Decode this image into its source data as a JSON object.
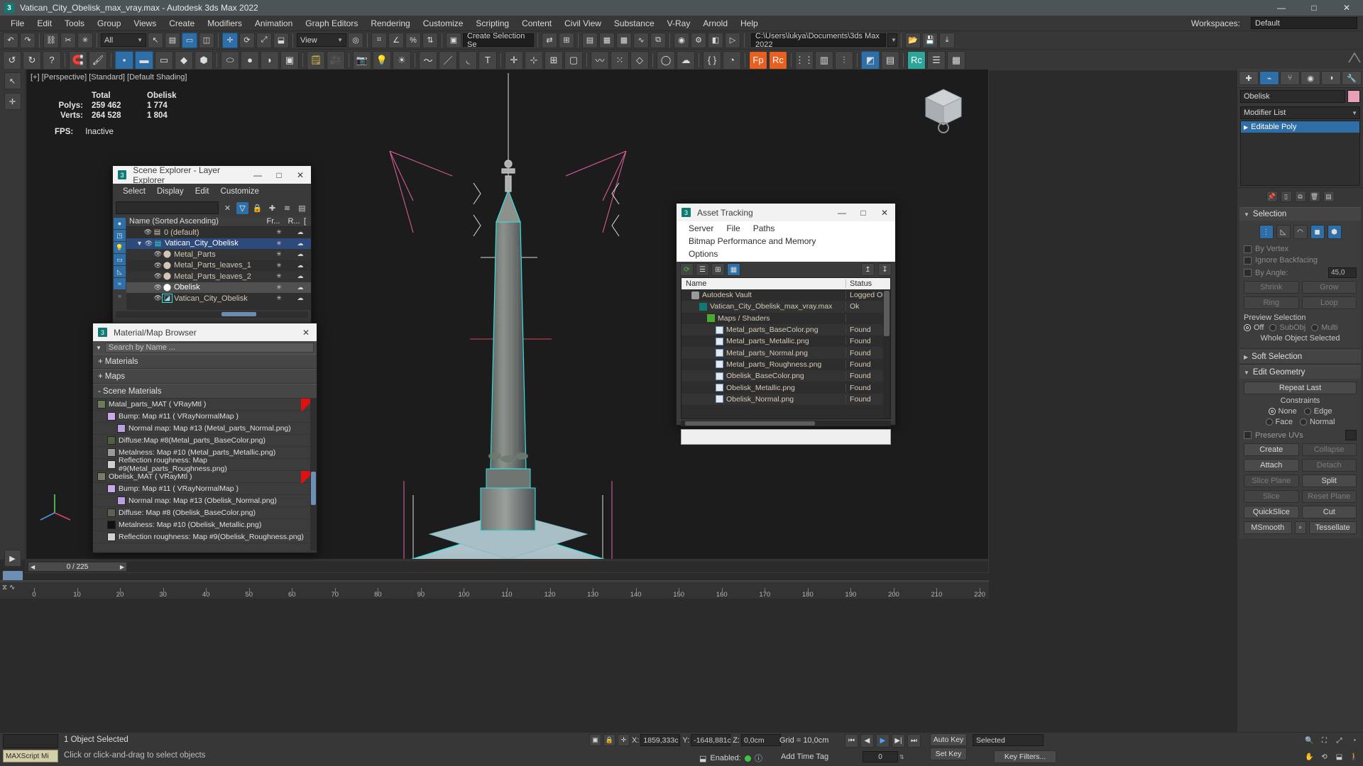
{
  "window": {
    "title": "Vatican_City_Obelisk_max_vray.max - Autodesk 3ds Max 2022",
    "app_icon": "3",
    "minimize": "—",
    "maximize": "□",
    "close": "✕"
  },
  "menubar": {
    "items": [
      "File",
      "Edit",
      "Tools",
      "Group",
      "Views",
      "Create",
      "Modifiers",
      "Animation",
      "Graph Editors",
      "Rendering",
      "Customize",
      "Scripting",
      "Content",
      "Civil View",
      "Substance",
      "V-Ray",
      "Arnold",
      "Help"
    ],
    "workspaces_label": "Workspaces:",
    "workspace_value": "Default"
  },
  "toolbar_row1": {
    "selection_filter": "All",
    "view_combo": "View",
    "selection_set": "Create Selection Se",
    "project_path": "C:\\Users\\lukya\\Documents\\3ds Max 2022"
  },
  "viewport": {
    "label": "[+] [Perspective] [Standard] [Default Shading]",
    "stats": {
      "col_total": "Total",
      "col_object": "Obelisk",
      "rows": [
        {
          "label": "Polys:",
          "total": "259 462",
          "obj": "1 774"
        },
        {
          "label": "Verts:",
          "total": "264 528",
          "obj": "1 804"
        }
      ],
      "fps_label": "FPS:",
      "fps_value": "Inactive"
    }
  },
  "scene_explorer": {
    "title": "Scene Explorer - Layer Explorer",
    "menu": [
      "Select",
      "Display",
      "Edit",
      "Customize"
    ],
    "search_value": "",
    "columns": {
      "name": "Name (Sorted Ascending)",
      "fr": "Fr...",
      "r": "R...",
      "extra": "["
    },
    "rows": [
      {
        "name": "0 (default)",
        "depth": 1,
        "type": "layer",
        "state": "normal"
      },
      {
        "name": "Vatican_City_Obelisk",
        "depth": 1,
        "type": "layer",
        "state": "selected",
        "expanded": true
      },
      {
        "name": "Metal_Parts",
        "depth": 2,
        "type": "object",
        "state": "normal"
      },
      {
        "name": "Metal_Parts_leaves_1",
        "depth": 2,
        "type": "object",
        "state": "normal"
      },
      {
        "name": "Metal_Parts_leaves_2",
        "depth": 2,
        "type": "object",
        "state": "normal"
      },
      {
        "name": "Obelisk",
        "depth": 2,
        "type": "object",
        "state": "highlight"
      },
      {
        "name": "Vatican_City_Obelisk",
        "depth": 2,
        "type": "mesh",
        "state": "normal"
      }
    ]
  },
  "material_browser": {
    "title": "Material/Map Browser",
    "search_placeholder": "Search by Name ...",
    "groups": [
      {
        "label": "+ Materials"
      },
      {
        "label": "+ Maps"
      },
      {
        "label": "- Scene Materials"
      }
    ],
    "entries": [
      {
        "text": "Matal_parts_MAT  ( VRayMtl )",
        "indent": 0,
        "swatch": "#6e7a5e",
        "red": true
      },
      {
        "text": "Bump: Map #11  ( VRayNormalMap )",
        "indent": 1,
        "swatch": "#c8a8e8",
        "red": false
      },
      {
        "text": "Normal map: Map #13 (Metal_parts_Normal.png)",
        "indent": 2,
        "swatch": "#b9a0e0",
        "red": false
      },
      {
        "text": "Diffuse:Map #8(Metal_parts_BaseColor.png)",
        "indent": 1,
        "swatch": "#4f5f3f",
        "red": false
      },
      {
        "text": "Metalness: Map #10 (Metal_parts_Metallic.png)",
        "indent": 1,
        "swatch": "#9a9a9a",
        "red": false
      },
      {
        "text": "Reflection roughness: Map #9(Metal_parts_Roughness.png)",
        "indent": 1,
        "swatch": "#cfcfcf",
        "red": false
      },
      {
        "text": "Obelisk_MAT  ( VRayMtl )",
        "indent": 0,
        "swatch": "#7a7a6a",
        "red": true
      },
      {
        "text": "Bump: Map #11  ( VRayNormalMap )",
        "indent": 1,
        "swatch": "#c8a8e8",
        "red": false
      },
      {
        "text": "Normal map: Map #13 (Obelisk_Normal.png)",
        "indent": 2,
        "swatch": "#b9a0e0",
        "red": false
      },
      {
        "text": "Diffuse: Map #8 (Obelisk_BaseColor.png)",
        "indent": 1,
        "swatch": "#5d6250",
        "red": false
      },
      {
        "text": "Metalness: Map #10 (Obelisk_Metallic.png)",
        "indent": 1,
        "swatch": "#111111",
        "red": false
      },
      {
        "text": "Reflection roughness: Map #9(Obelisk_Roughness.png)",
        "indent": 1,
        "swatch": "#d0d0d0",
        "red": false
      }
    ]
  },
  "asset_tracking": {
    "title": "Asset Tracking",
    "menu": [
      "Server",
      "File",
      "Paths",
      "Bitmap Performance and Memory",
      "Options"
    ],
    "columns": {
      "name": "Name",
      "status": "Status"
    },
    "rows": [
      {
        "name": "Autodesk Vault",
        "status": "Logged Out",
        "indent": 1,
        "icon": "vault"
      },
      {
        "name": "Vatican_City_Obelisk_max_vray.max",
        "status": "Ok",
        "indent": 2,
        "icon": "max"
      },
      {
        "name": "Maps / Shaders",
        "status": "",
        "indent": 3,
        "icon": "maps"
      },
      {
        "name": "Metal_parts_BaseColor.png",
        "status": "Found",
        "indent": 4,
        "icon": "img"
      },
      {
        "name": "Metal_parts_Metallic.png",
        "status": "Found",
        "indent": 4,
        "icon": "img"
      },
      {
        "name": "Metal_parts_Normal.png",
        "status": "Found",
        "indent": 4,
        "icon": "img"
      },
      {
        "name": "Metal_parts_Roughness.png",
        "status": "Found",
        "indent": 4,
        "icon": "img"
      },
      {
        "name": "Obelisk_BaseColor.png",
        "status": "Found",
        "indent": 4,
        "icon": "img"
      },
      {
        "name": "Obelisk_Metallic.png",
        "status": "Found",
        "indent": 4,
        "icon": "img"
      },
      {
        "name": "Obelisk_Normal.png",
        "status": "Found",
        "indent": 4,
        "icon": "img"
      }
    ],
    "status_text": ""
  },
  "command_panel": {
    "object_name": "Obelisk",
    "modifier_list_label": "Modifier List",
    "modifier_stack": [
      "Editable Poly"
    ],
    "rollouts": {
      "selection": {
        "title": "Selection",
        "by_vertex": "By Vertex",
        "ignore_backfacing": "Ignore Backfacing",
        "by_angle": "By Angle:",
        "by_angle_value": "45,0",
        "shrink": "Shrink",
        "grow": "Grow",
        "ring": "Ring",
        "loop": "Loop",
        "preview_selection": "Preview Selection",
        "preview_off": "Off",
        "preview_subobj": "SubObj",
        "preview_multi": "Multi",
        "whole_object": "Whole Object Selected"
      },
      "soft_selection": {
        "title": "Soft Selection"
      },
      "edit_geometry": {
        "title": "Edit Geometry",
        "repeat_last": "Repeat Last",
        "constraints_label": "Constraints",
        "constraint_none": "None",
        "constraint_edge": "Edge",
        "constraint_face": "Face",
        "constraint_normal": "Normal",
        "preserve_uvs": "Preserve UVs",
        "create": "Create",
        "collapse": "Collapse",
        "attach": "Attach",
        "detach": "Detach",
        "slice_plane": "Slice Plane",
        "split": "Split",
        "slice": "Slice",
        "reset_plane": "Reset Plane",
        "quickslice": "QuickSlice",
        "cut": "Cut",
        "msmooth": "MSmooth",
        "tessellate": "Tessellate"
      }
    }
  },
  "timeline": {
    "frame_indicator": "0 / 225",
    "ruler_ticks": [
      "0",
      "10",
      "20",
      "30",
      "40",
      "50",
      "60",
      "70",
      "80",
      "90",
      "100",
      "110",
      "120",
      "130",
      "140",
      "150",
      "160",
      "170",
      "180",
      "190",
      "200",
      "210",
      "220"
    ]
  },
  "statusbar": {
    "maxscript_label": "MAXScript Mi",
    "selection_text": "1 Object Selected",
    "prompt_text": "Click or click-and-drag to select objects",
    "x_label": "X:",
    "x_value": "1859,333c",
    "y_label": "Y:",
    "y_value": "-1648,881c",
    "z_label": "Z:",
    "z_value": "0,0cm",
    "grid_text": "Grid = 10,0cm",
    "enabled_label": "Enabled:",
    "add_time_tag": "Add Time Tag",
    "auto_key": "Auto Key",
    "set_key": "Set Key",
    "selected_combo": "Selected",
    "key_filters": "Key Filters...",
    "key_value": "0"
  },
  "colors": {
    "accent_blue": "#2f6fa8",
    "panel_bg": "#373737",
    "viewport_bg": "#1c1c1c",
    "selection_cyan": "#35e0e0",
    "helper_pink": "#e85fa0",
    "status_green": "#3ec43e"
  }
}
